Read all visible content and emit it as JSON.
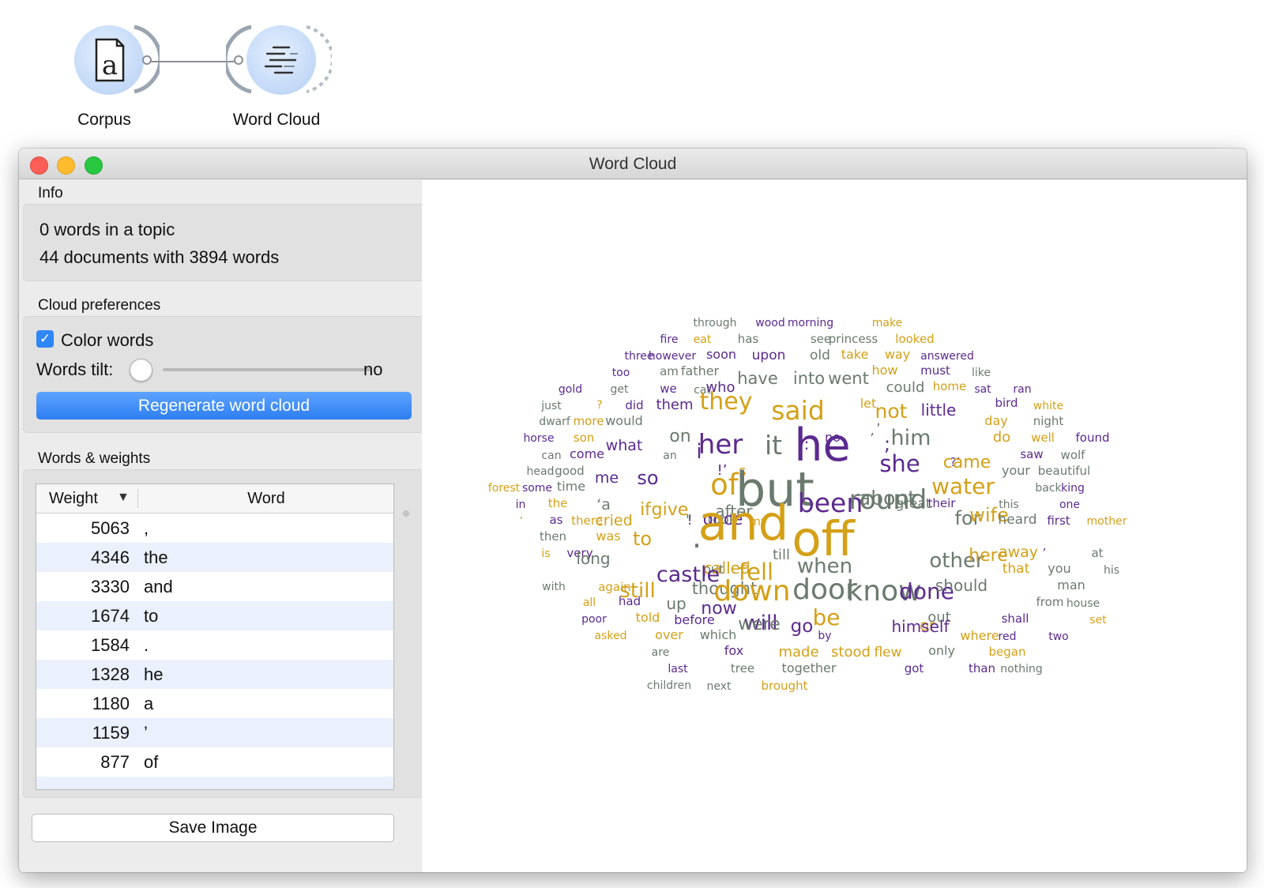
{
  "workflow": {
    "nodes": [
      {
        "label": "Corpus",
        "icon": "document-a-icon"
      },
      {
        "label": "Word Cloud",
        "icon": "word-cloud-icon"
      }
    ]
  },
  "window": {
    "title": "Word Cloud"
  },
  "info": {
    "section": "Info",
    "line1": "0 words in a topic",
    "line2": "44 documents with 3894 words"
  },
  "prefs": {
    "section": "Cloud preferences",
    "color_words_label": "Color words",
    "color_words_checked": true,
    "tilt_label": "Words tilt:",
    "tilt_value": "no",
    "regenerate_label": "Regenerate word cloud"
  },
  "weights": {
    "section": "Words & weights",
    "col_weight": "Weight",
    "col_word": "Word",
    "rows": [
      {
        "weight": "5063",
        "word": ","
      },
      {
        "weight": "4346",
        "word": "the"
      },
      {
        "weight": "3330",
        "word": "and"
      },
      {
        "weight": "1674",
        "word": "to"
      },
      {
        "weight": "1584",
        "word": "."
      },
      {
        "weight": "1328",
        "word": "he"
      },
      {
        "weight": "1180",
        "word": "a"
      },
      {
        "weight": "1159",
        "word": "’"
      },
      {
        "weight": "877",
        "word": "of"
      }
    ]
  },
  "save_label": "Save Image",
  "cloud_colors": {
    "gold": "#d4a017",
    "purple": "#5b2a8f",
    "gray": "#6b7a6e"
  },
  "cloud_words": [
    {
      "t": "through",
      "c": "gray"
    },
    {
      "t": "wood",
      "c": "purple"
    },
    {
      "t": "morning",
      "c": "purple"
    },
    {
      "t": "make",
      "c": "gold"
    },
    {
      "t": "fire",
      "c": "purple"
    },
    {
      "t": "eat",
      "c": "gold"
    },
    {
      "t": "has",
      "c": "gray"
    },
    {
      "t": "see",
      "c": "gray"
    },
    {
      "t": "princess",
      "c": "gray"
    },
    {
      "t": "looked",
      "c": "gold"
    },
    {
      "t": "three",
      "c": "purple"
    },
    {
      "t": "however",
      "c": "purple"
    },
    {
      "t": "soon",
      "c": "purple"
    },
    {
      "t": "upon",
      "c": "purple"
    },
    {
      "t": "old",
      "c": "gray"
    },
    {
      "t": "take",
      "c": "gold"
    },
    {
      "t": "way",
      "c": "gold"
    },
    {
      "t": "answered",
      "c": "purple"
    },
    {
      "t": "too",
      "c": "purple"
    },
    {
      "t": "am",
      "c": "gray"
    },
    {
      "t": "father",
      "c": "gray"
    },
    {
      "t": "how",
      "c": "gold"
    },
    {
      "t": "must",
      "c": "purple"
    },
    {
      "t": "like",
      "c": "gray"
    },
    {
      "t": "gold",
      "c": "purple"
    },
    {
      "t": "get",
      "c": "gray"
    },
    {
      "t": "we",
      "c": "purple"
    },
    {
      "t": "cat",
      "c": "gray"
    },
    {
      "t": "who",
      "c": "purple"
    },
    {
      "t": "have",
      "c": "gray"
    },
    {
      "t": "into",
      "c": "gray"
    },
    {
      "t": "went",
      "c": "gray"
    },
    {
      "t": "could",
      "c": "gray"
    },
    {
      "t": "home",
      "c": "gold"
    },
    {
      "t": "sat",
      "c": "purple"
    },
    {
      "t": "ran",
      "c": "purple"
    },
    {
      "t": "just",
      "c": "gray"
    },
    {
      "t": "?",
      "c": "gold"
    },
    {
      "t": "did",
      "c": "purple"
    },
    {
      "t": "them",
      "c": "purple"
    },
    {
      "t": "they",
      "c": "gold"
    },
    {
      "t": "said",
      "c": "gold"
    },
    {
      "t": "let",
      "c": "gold"
    },
    {
      "t": "not",
      "c": "gold"
    },
    {
      "t": "little",
      "c": "purple"
    },
    {
      "t": "bird",
      "c": "purple"
    },
    {
      "t": "white",
      "c": "gold"
    },
    {
      "t": "dwarf",
      "c": "gray"
    },
    {
      "t": "more",
      "c": "gold"
    },
    {
      "t": "would",
      "c": "gray"
    },
    {
      "t": ",",
      "c": "gray"
    },
    {
      "t": "day",
      "c": "gold"
    },
    {
      "t": "night",
      "c": "gray"
    },
    {
      "t": "horse",
      "c": "purple"
    },
    {
      "t": "son",
      "c": "gold"
    },
    {
      "t": "on",
      "c": "gray"
    },
    {
      "t": "no",
      "c": "purple"
    },
    {
      "t": "’",
      "c": "gray"
    },
    {
      "t": "do",
      "c": "gold"
    },
    {
      "t": "well",
      "c": "gold"
    },
    {
      "t": "found",
      "c": "purple"
    },
    {
      "t": "can",
      "c": "gray"
    },
    {
      "t": "come",
      "c": "purple"
    },
    {
      "t": "what",
      "c": "purple"
    },
    {
      "t": "an",
      "c": "gray"
    },
    {
      "t": "i",
      "c": "purple"
    },
    {
      "t": "her",
      "c": "purple"
    },
    {
      "t": "it",
      "c": "gray"
    },
    {
      "t": ":",
      "c": "purple"
    },
    {
      "t": "he",
      "c": "purple"
    },
    {
      "t": ";",
      "c": "purple"
    },
    {
      "t": "him",
      "c": "gray"
    },
    {
      "t": "saw",
      "c": "purple"
    },
    {
      "t": "wolf",
      "c": "gray"
    },
    {
      "t": "head",
      "c": "gray"
    },
    {
      "t": "good",
      "c": "gray"
    },
    {
      "t": "!’",
      "c": "purple"
    },
    {
      "t": "s",
      "c": "gold"
    },
    {
      "t": "she",
      "c": "purple"
    },
    {
      "t": "?’",
      "c": "purple"
    },
    {
      "t": "came",
      "c": "gold"
    },
    {
      "t": "your",
      "c": "gray"
    },
    {
      "t": "beautiful",
      "c": "gray"
    },
    {
      "t": "forest",
      "c": "gold"
    },
    {
      "t": "some",
      "c": "purple"
    },
    {
      "t": "time",
      "c": "gray"
    },
    {
      "t": "me",
      "c": "purple"
    },
    {
      "t": "so",
      "c": "purple"
    },
    {
      "t": "of",
      "c": "gold"
    },
    {
      "t": "but",
      "c": "gray"
    },
    {
      "t": "about",
      "c": "gray"
    },
    {
      "t": "water",
      "c": "gold"
    },
    {
      "t": "back",
      "c": "gray"
    },
    {
      "t": "king",
      "c": "purple"
    },
    {
      "t": "in",
      "c": "purple"
    },
    {
      "t": "the",
      "c": "gold"
    },
    {
      "t": "‘a",
      "c": "gray"
    },
    {
      "t": "if",
      "c": "gold"
    },
    {
      "t": "!",
      "c": "purple"
    },
    {
      "t": "took",
      "c": "gray"
    },
    {
      "t": "after",
      "c": "gray"
    },
    {
      "t": "been",
      "c": "purple"
    },
    {
      "t": "round",
      "c": "gray"
    },
    {
      "t": "great",
      "c": "gray"
    },
    {
      "t": "their",
      "c": "purple"
    },
    {
      "t": "for",
      "c": "gray"
    },
    {
      "t": "this",
      "c": "gray"
    },
    {
      "t": "one",
      "c": "purple"
    },
    {
      "t": "‘",
      "c": "gold"
    },
    {
      "t": "as",
      "c": "purple"
    },
    {
      "t": "there",
      "c": "gold"
    },
    {
      "t": "cried",
      "c": "gold"
    },
    {
      "t": "give",
      "c": "gold"
    },
    {
      "t": "\"",
      "c": "gray"
    },
    {
      "t": "once",
      "c": "purple"
    },
    {
      "t": "my",
      "c": "gold"
    },
    {
      "t": "wife",
      "c": "gold"
    },
    {
      "t": "heard",
      "c": "gray"
    },
    {
      "t": "first",
      "c": "purple"
    },
    {
      "t": "mother",
      "c": "gold"
    },
    {
      "t": "then",
      "c": "gray"
    },
    {
      "t": "was",
      "c": "gold"
    },
    {
      "t": "to",
      "c": "gold"
    },
    {
      "t": ".",
      "c": "gray"
    },
    {
      "t": "and",
      "c": "gold"
    },
    {
      "t": "till",
      "c": "gray"
    },
    {
      "t": "off",
      "c": "gold"
    },
    {
      "t": "other",
      "c": "gray"
    },
    {
      "t": "here",
      "c": "gold"
    },
    {
      "t": "away",
      "c": "gold"
    },
    {
      "t": "’",
      "c": "purple"
    },
    {
      "t": "at",
      "c": "gray"
    },
    {
      "t": "is",
      "c": "gold"
    },
    {
      "t": "very",
      "c": "purple"
    },
    {
      "t": "long",
      "c": "gray"
    },
    {
      "t": "put",
      "c": "gray"
    },
    {
      "t": "called",
      "c": "gold"
    },
    {
      "t": "fell",
      "c": "gold"
    },
    {
      "t": "when",
      "c": "gray"
    },
    {
      "t": "that",
      "c": "gold"
    },
    {
      "t": "you",
      "c": "gray"
    },
    {
      "t": "his",
      "c": "gray"
    },
    {
      "t": "with",
      "c": "gray"
    },
    {
      "t": "again",
      "c": "gold"
    },
    {
      "t": "still",
      "c": "gold"
    },
    {
      "t": "castle",
      "c": "purple"
    },
    {
      "t": "thought",
      "c": "gray"
    },
    {
      "t": "down",
      "c": "gold"
    },
    {
      "t": "door",
      "c": "gray"
    },
    {
      "t": "know",
      "c": "gray"
    },
    {
      "t": "done",
      "c": "purple"
    },
    {
      "t": "should",
      "c": "gray"
    },
    {
      "t": "man",
      "c": "gray"
    },
    {
      "t": "all",
      "c": "gold"
    },
    {
      "t": "had",
      "c": "purple"
    },
    {
      "t": "up",
      "c": "gray"
    },
    {
      "t": "from",
      "c": "gray"
    },
    {
      "t": "house",
      "c": "gray"
    },
    {
      "t": "poor",
      "c": "purple"
    },
    {
      "t": "told",
      "c": "gold"
    },
    {
      "t": "before",
      "c": "purple"
    },
    {
      "t": "now",
      "c": "purple"
    },
    {
      "t": "will",
      "c": "purple"
    },
    {
      "t": "be",
      "c": "gold"
    },
    {
      "t": "or",
      "c": "gold"
    },
    {
      "t": "out",
      "c": "gray"
    },
    {
      "t": "shall",
      "c": "purple"
    },
    {
      "t": "set",
      "c": "gold"
    },
    {
      "t": "asked",
      "c": "gold"
    },
    {
      "t": "over",
      "c": "gold"
    },
    {
      "t": "which",
      "c": "gray"
    },
    {
      "t": "were",
      "c": "gray"
    },
    {
      "t": "go",
      "c": "purple"
    },
    {
      "t": "by",
      "c": "purple"
    },
    {
      "t": "himself",
      "c": "purple"
    },
    {
      "t": "where",
      "c": "gold"
    },
    {
      "t": "red",
      "c": "purple"
    },
    {
      "t": "two",
      "c": "purple"
    },
    {
      "t": "are",
      "c": "gray"
    },
    {
      "t": "fox",
      "c": "purple"
    },
    {
      "t": "made",
      "c": "gold"
    },
    {
      "t": "stood",
      "c": "gold"
    },
    {
      "t": "flew",
      "c": "gold"
    },
    {
      "t": "only",
      "c": "gray"
    },
    {
      "t": "began",
      "c": "gold"
    },
    {
      "t": "last",
      "c": "purple"
    },
    {
      "t": "tree",
      "c": "gray"
    },
    {
      "t": "together",
      "c": "gray"
    },
    {
      "t": "got",
      "c": "purple"
    },
    {
      "t": "than",
      "c": "purple"
    },
    {
      "t": "nothing",
      "c": "gray"
    },
    {
      "t": "children",
      "c": "gray"
    },
    {
      "t": "next",
      "c": "gray"
    },
    {
      "t": "brought",
      "c": "gold"
    }
  ]
}
